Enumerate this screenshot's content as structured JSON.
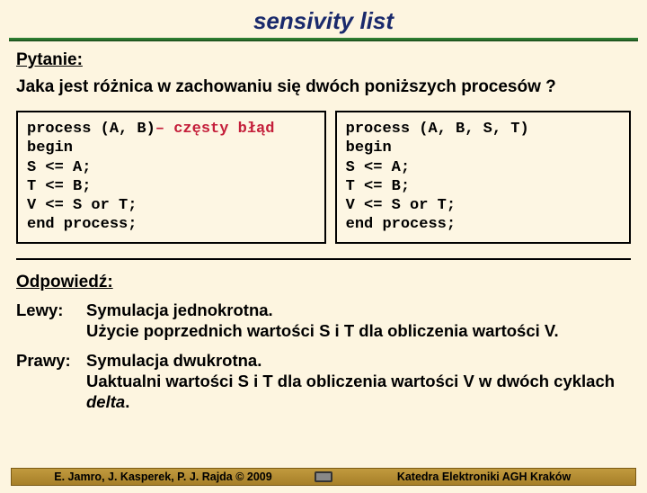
{
  "title": "sensivity list",
  "question": {
    "label": "Pytanie:",
    "text": "Jaka jest różnica w zachowaniu się dwóch poniższych procesów ?"
  },
  "code_left": {
    "l1a": "process (A, B)",
    "l1b": "– częsty błąd",
    "l2": "begin",
    "l3": "S <= A;",
    "l4": "T <= B;",
    "l5": "V <= S or T;",
    "l6": "end process;"
  },
  "code_right": {
    "l1": "process (A, B, S, T)",
    "l2": "begin",
    "l3": "S <= A;",
    "l4": "T <= B;",
    "l5": "V <= S or T;",
    "l6": "end process;"
  },
  "answer": {
    "label": "Odpowiedź:",
    "left_key": "Lewy:",
    "left_val_l1": "Symulacja jednokrotna.",
    "left_val_l2": "Użycie poprzednich wartości S i T dla obliczenia wartości V.",
    "right_key": "Prawy:",
    "right_val_l1": "Symulacja dwukrotna.",
    "right_val_l2": "Uaktualni wartości S i T dla obliczenia wartości V w dwóch cyklach ",
    "right_val_l3a": "delta",
    "right_val_l3b": "."
  },
  "footer": {
    "left": "E. Jamro, J. Kasperek, P. J. Rajda © 2009",
    "right": "Katedra Elektroniki AGH Kraków"
  }
}
